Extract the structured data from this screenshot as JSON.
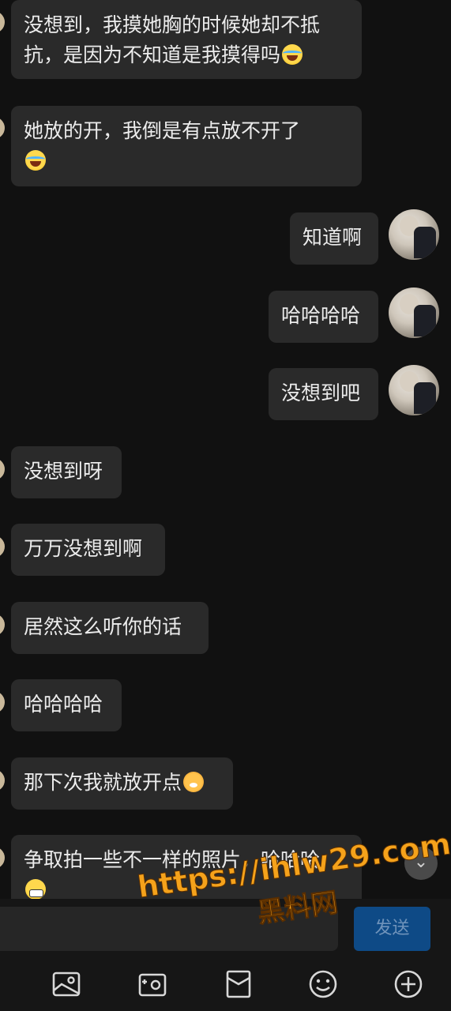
{
  "messages": [
    {
      "side": "left",
      "text": "没想到，我摸她胸的时候她却不抵抗，是因为不知道是我摸得吗",
      "emoji": "face-with-tears-of-joy"
    },
    {
      "side": "left",
      "text": "她放的开，我倒是有点放不开了",
      "emoji": "face-with-tears-of-joy"
    },
    {
      "side": "right",
      "text": "知道啊"
    },
    {
      "side": "right",
      "text": "哈哈哈哈"
    },
    {
      "side": "right",
      "text": "没想到吧"
    },
    {
      "side": "left",
      "text": "没想到呀"
    },
    {
      "side": "left",
      "text": "万万没想到啊"
    },
    {
      "side": "left",
      "text": "居然这么听你的话"
    },
    {
      "side": "left",
      "text": "哈哈哈哈"
    },
    {
      "side": "left",
      "text": "那下次我就放开点",
      "emoji": "tiger-face"
    },
    {
      "side": "left",
      "text": "争取拍一些不一样的照片，哈哈哈",
      "emoji": "grimacing-face"
    }
  ],
  "input": {
    "placeholder": "",
    "send_label": "发送"
  },
  "toolbar": {
    "items": [
      "image-icon",
      "camera-icon",
      "red-packet-icon",
      "emoji-icon",
      "plus-icon"
    ]
  },
  "watermark": {
    "url": "https://ihlw29.com",
    "name": "黑料网"
  },
  "colors": {
    "background": "#111111",
    "bubble": "#2a2a2a",
    "text": "#ececec",
    "send_button": "#0e4a86",
    "watermark": "#f5a21b"
  }
}
